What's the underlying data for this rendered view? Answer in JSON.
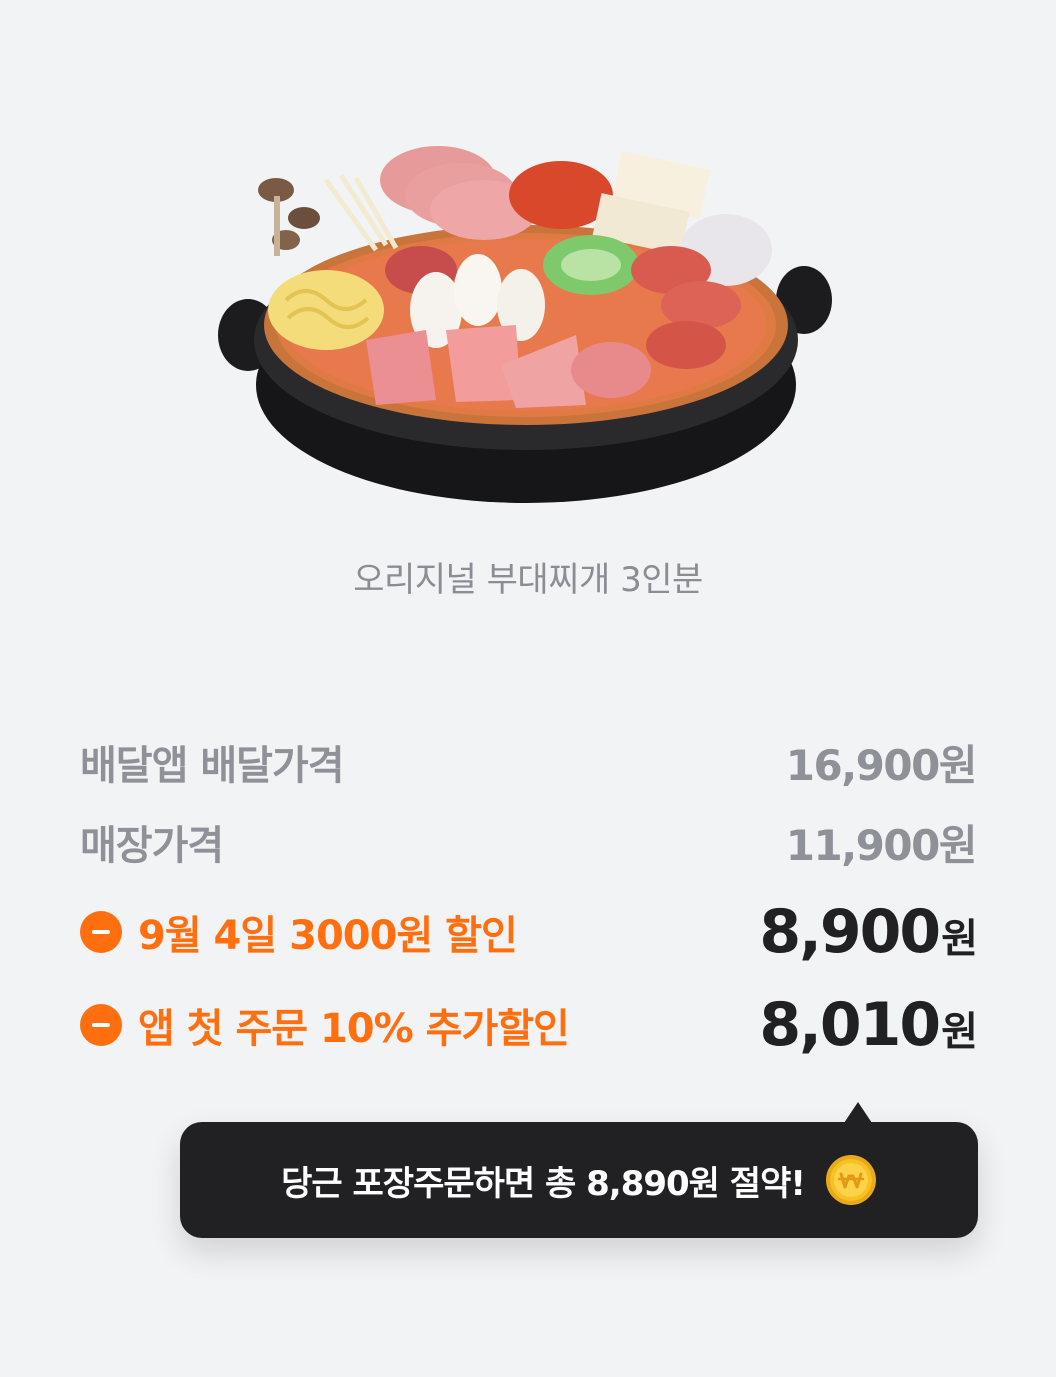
{
  "product": {
    "name": "오리지널 부대찌개 3인분",
    "image_icon": "budae-jjigae-food-photo"
  },
  "prices": [
    {
      "label": "배달앱 배달가격",
      "value": "16,900원"
    },
    {
      "label": "매장가격",
      "value": "11,900원"
    }
  ],
  "discounts": [
    {
      "label": "9월 4일 3000원 할인",
      "amount": "8,900",
      "unit": "원"
    },
    {
      "label": "앱 첫 주문 10% 추가할인",
      "amount": "8,010",
      "unit": "원"
    }
  ],
  "tooltip": {
    "text": "당근 포장주문하면 총 8,890원 절약!",
    "icon": "won-coin-icon"
  },
  "colors": {
    "background": "#f2f3f5",
    "accent": "#ff6f0f",
    "muted_text": "#8e9198",
    "dark_text": "#212124",
    "tooltip_bg": "#212124",
    "coin": "#f7c221"
  }
}
